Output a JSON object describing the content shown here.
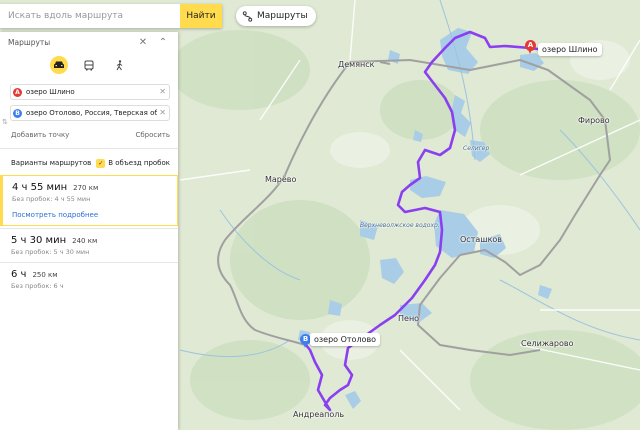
{
  "search": {
    "placeholder": "Искать вдоль маршрута",
    "button_label": "Найти"
  },
  "routes_chip": {
    "label": "Маршруты",
    "icon": "route-icon"
  },
  "panel": {
    "title": "Маршруты",
    "modes": [
      {
        "name": "car",
        "icon": "car-icon",
        "active": true
      },
      {
        "name": "transit",
        "icon": "bus-icon",
        "active": false
      },
      {
        "name": "walk",
        "icon": "walk-icon",
        "active": false
      }
    ],
    "point_a": {
      "badge": "A",
      "value": "озеро Шлино"
    },
    "point_b": {
      "badge": "B",
      "value": "озеро Отолово, Россия, Тверская обла"
    },
    "add_point": "Добавить точку",
    "reset": "Сбросить",
    "variants_label": "Варианты маршрутов",
    "avoid_traffic": {
      "label": "В объезд пробок",
      "checked": true
    },
    "routes": [
      {
        "time": "4 ч 55 мин",
        "distance": "270 км",
        "sub": "Без пробок: 4 ч 55 мин",
        "selected": true,
        "more": "Посмотреть подробнее"
      },
      {
        "time": "5 ч 30 мин",
        "distance": "240 км",
        "sub": "Без пробок: 5 ч 30 мин",
        "selected": false
      },
      {
        "time": "6 ч",
        "distance": "250 км",
        "sub": "Без пробок: 6 ч",
        "selected": false
      }
    ]
  },
  "map": {
    "route_color": "#8a3ff0",
    "alt_route_color": "#9e9e9e",
    "marker_a_label": "озеро Шлино",
    "marker_b_label": "озеро Отолово",
    "places": {
      "demyansk": "Демянск",
      "firovo": "Фирово",
      "maryovo": "Марёво",
      "ostashkov": "Осташков",
      "peno": "Пено",
      "selizharovo": "Селижарово",
      "andreapol": "Андреаполь",
      "seliger": "Селигер",
      "verkhnevolzhskoe": "Верхневолжское водохр."
    }
  }
}
